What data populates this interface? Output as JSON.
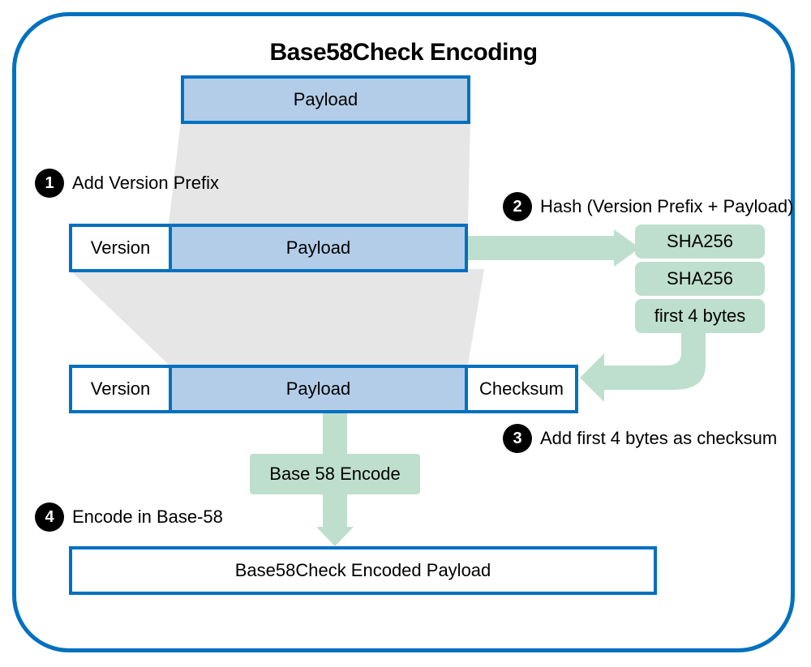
{
  "title": "Base58Check Encoding",
  "labels": {
    "payload": "Payload",
    "version": "Version",
    "checksum": "Checksum",
    "base58encode": "Base 58 Encode",
    "final": "Base58Check Encoded Payload",
    "sha256": "SHA256",
    "first4": "first 4 bytes"
  },
  "steps": {
    "s1": "Add Version Prefix",
    "s2": "Hash (Version Prefix + Payload)",
    "s3": "Add first 4 bytes as checksum",
    "s4": "Encode in Base-58"
  },
  "colors": {
    "border_blue": "#0070c0",
    "fill_blue": "#b3cde8",
    "fill_green": "#bedfce",
    "fill_grey": "#e6e6e6"
  }
}
